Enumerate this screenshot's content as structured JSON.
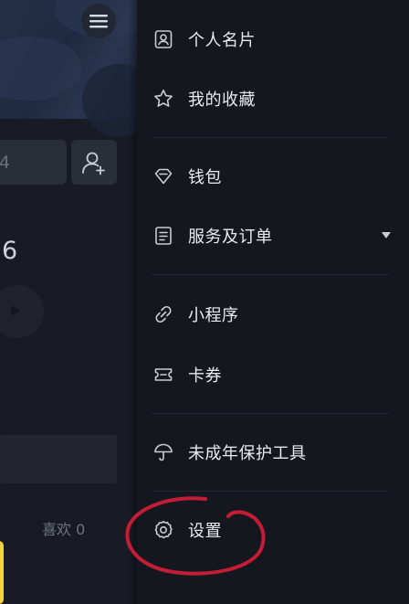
{
  "background_page": {
    "partial_number": "4",
    "big_number": "6",
    "likes_tab": "喜欢 0"
  },
  "drawer": {
    "items": [
      {
        "label": "个人名片",
        "icon": "id-card-icon"
      },
      {
        "label": "我的收藏",
        "icon": "star-icon"
      },
      {
        "label": "钱包",
        "icon": "diamond-wallet-icon"
      },
      {
        "label": "服务及订单",
        "icon": "document-list-icon",
        "has_dropdown": true
      },
      {
        "label": "小程序",
        "icon": "mini-program-link-icon"
      },
      {
        "label": "卡券",
        "icon": "ticket-icon"
      },
      {
        "label": "未成年保护工具",
        "icon": "umbrella-icon"
      },
      {
        "label": "设置",
        "icon": "gear-icon"
      }
    ]
  },
  "colors": {
    "drawer_bg": "#15171f",
    "text": "#e9ebef",
    "icon": "#c9ccd3",
    "annotation": "#c21d35",
    "accent_yellow": "#f3d23a"
  },
  "annotation": {
    "type": "hand-drawn red circle",
    "target": "设置"
  }
}
